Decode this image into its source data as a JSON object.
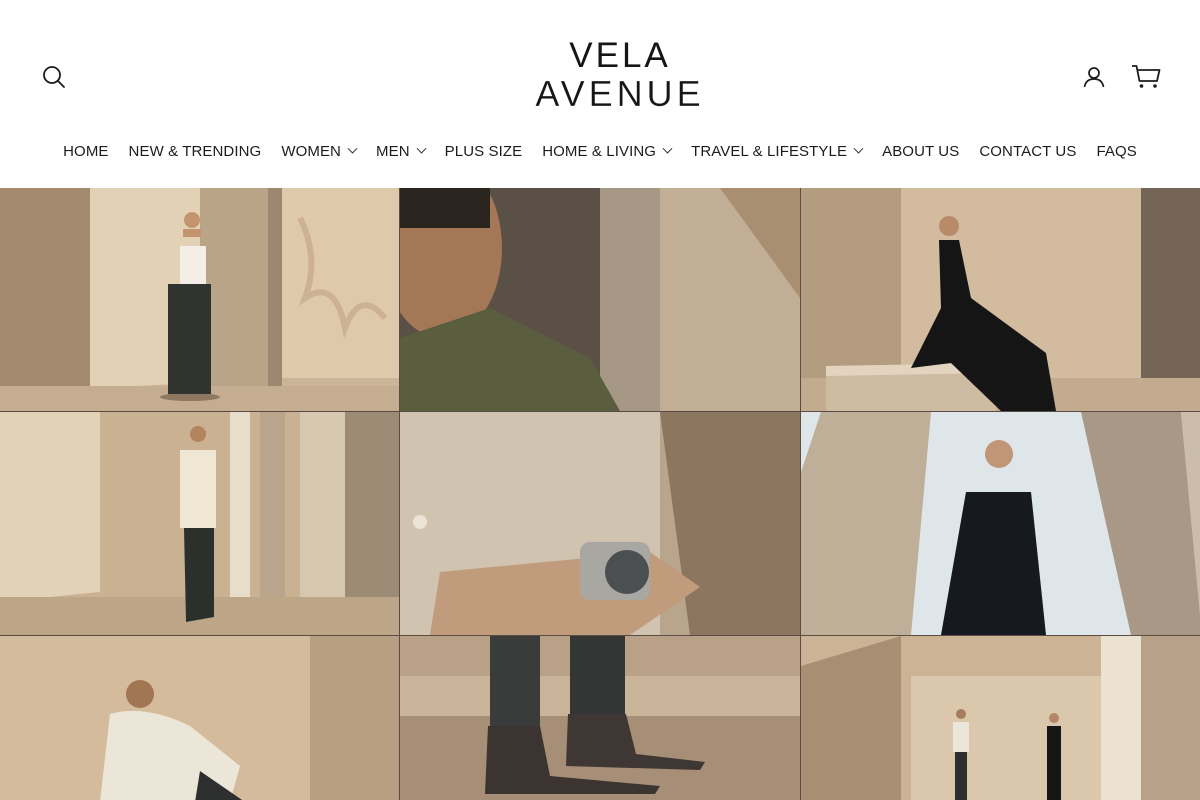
{
  "header": {
    "logo_line1": "VELA",
    "logo_line2": "AVENUE",
    "icons": {
      "search": "search-icon",
      "account": "user-icon",
      "cart": "cart-icon"
    }
  },
  "nav": {
    "items": [
      {
        "label": "HOME",
        "has_dropdown": false
      },
      {
        "label": "NEW & TRENDING",
        "has_dropdown": false
      },
      {
        "label": "WOMEN",
        "has_dropdown": true
      },
      {
        "label": "MEN",
        "has_dropdown": true
      },
      {
        "label": "PLUS SIZE",
        "has_dropdown": false
      },
      {
        "label": "HOME & LIVING",
        "has_dropdown": true
      },
      {
        "label": "TRAVEL & LIFESTYLE",
        "has_dropdown": true
      },
      {
        "label": "ABOUT US",
        "has_dropdown": false
      },
      {
        "label": "CONTACT US",
        "has_dropdown": false
      },
      {
        "label": "FAQS",
        "has_dropdown": false
      }
    ]
  },
  "colors": {
    "text": "#1c1c1c",
    "background": "#ffffff",
    "stone": "#d9c5ab",
    "shadow": "#8a7560"
  }
}
